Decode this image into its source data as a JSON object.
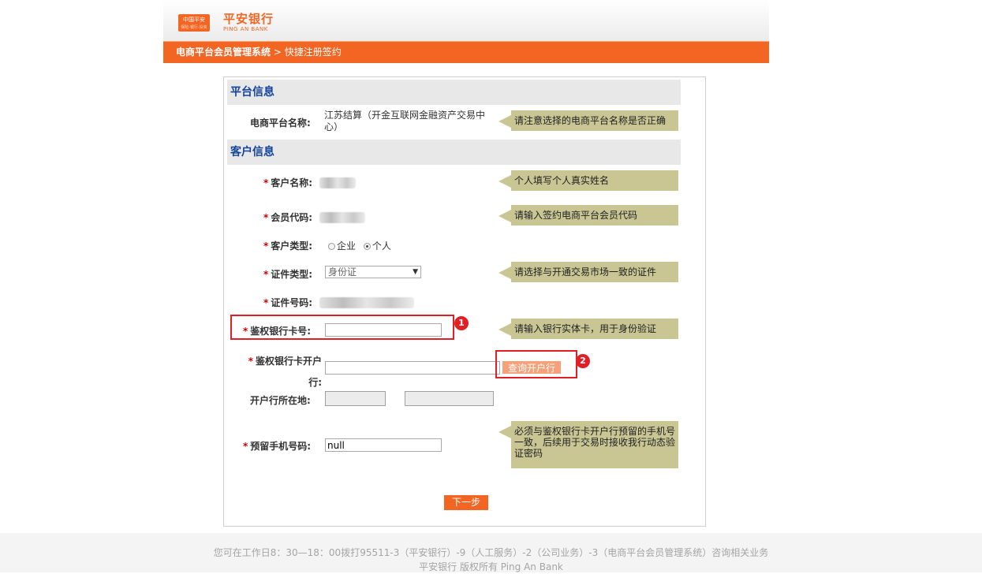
{
  "header": {
    "logo_box_line1": "中国平安",
    "logo_box_line2": "保险·银行·投资",
    "logo_cn": "平安银行",
    "logo_en": "PING AN BANK"
  },
  "breadcrumb": {
    "root": "电商平台会员管理系统",
    "separator": " > ",
    "current": "快捷注册签约"
  },
  "platform_section": {
    "title": "平台信息",
    "name_label": "电商平台名称:",
    "name_value": "江苏结算（开金互联网金融资产交易中心）",
    "name_tip": "请注意选择的电商平台名称是否正确"
  },
  "customer_section": {
    "title": "客户信息",
    "required_mark": "*",
    "name_label": "客户名称:",
    "name_tip": "个人填写个人真实姓名",
    "member_code_label": "会员代码:",
    "member_code_tip": "请输入签约电商平台会员代码",
    "type_label": "客户类型:",
    "type_options": [
      "企业",
      "个人"
    ],
    "type_selected": "个人",
    "id_type_label": "证件类型:",
    "id_type_value": "身份证",
    "id_type_tip": "请选择与开通交易市场一致的证件",
    "id_number_label": "证件号码:",
    "card_label": "鉴权银行卡号:",
    "card_value": "",
    "card_tip": "请输入银行实体卡，用于身份验证",
    "bank_label_line1": "鉴权银行卡开户",
    "bank_label_line2": "行:",
    "bank_value": "",
    "query_button": "查询开户行",
    "location_label": "开户行所在地:",
    "location_value1": "",
    "location_value2": "",
    "phone_label": "预留手机号码:",
    "phone_value": "null",
    "phone_tip": "必须与鉴权银行卡开户行预留的手机号一致，后续用于交易时接收我行动态验证密码",
    "next_button": "下一步"
  },
  "annotations": {
    "marker1": "1",
    "marker2": "2",
    "highlight_color": "#e31f26"
  },
  "footer": {
    "line1": "您可在工作日8：30—18：00拨打95511-3（平安银行）-9（人工服务）-2（公司业务）-3（电商平台会员管理系统）咨询相关业务",
    "line2": "平安银行 版权所有 Ping An Bank"
  },
  "colors": {
    "brand_orange": "#f26522",
    "section_title_blue": "#13439b",
    "tip_background": "#c9c694"
  }
}
